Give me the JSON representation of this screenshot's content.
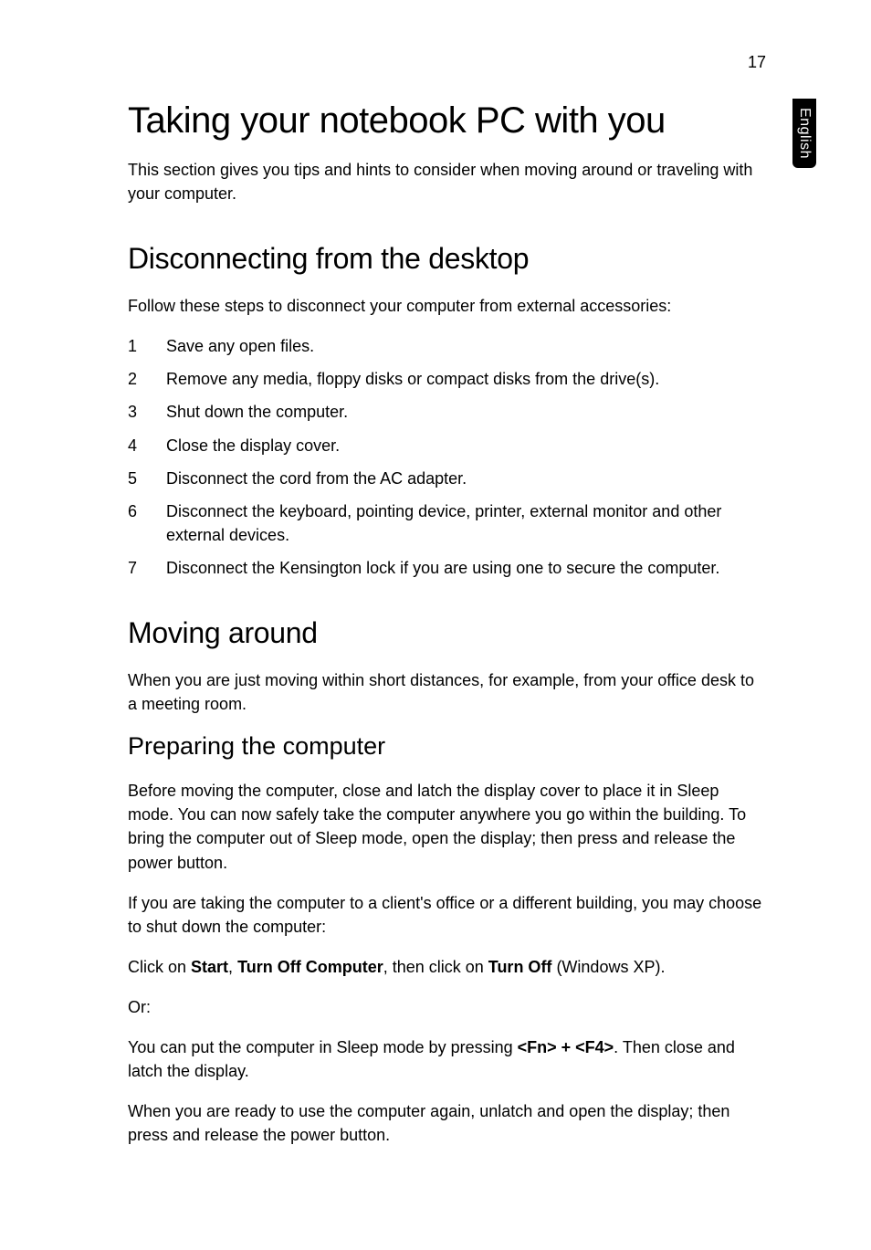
{
  "page_number": "17",
  "side_tab": "English",
  "h1": "Taking your notebook PC with you",
  "intro": "This section gives you tips and hints to consider when moving around or traveling with your computer.",
  "section1": {
    "heading": "Disconnecting from the desktop",
    "intro": "Follow these steps to disconnect your computer from external accessories:",
    "steps": [
      {
        "n": "1",
        "t": "Save any open files."
      },
      {
        "n": "2",
        "t": "Remove any media, floppy disks or compact disks from the drive(s)."
      },
      {
        "n": "3",
        "t": "Shut down the computer."
      },
      {
        "n": "4",
        "t": "Close the display cover."
      },
      {
        "n": "5",
        "t": "Disconnect the cord from the AC adapter."
      },
      {
        "n": "6",
        "t": "Disconnect the keyboard, pointing device, printer, external monitor and other external devices."
      },
      {
        "n": "7",
        "t": "Disconnect the Kensington lock if you are using one to secure the computer."
      }
    ]
  },
  "section2": {
    "heading": "Moving around",
    "intro": "When you are just moving within short distances, for example, from your office desk to a meeting room.",
    "sub": {
      "heading": "Preparing the computer",
      "p1": "Before moving the computer, close and latch the display cover to place it in Sleep mode. You can now safely take the computer anywhere you go within the building. To bring the computer out of Sleep mode, open the display; then press and release the power button.",
      "p2": "If you are taking the computer to a client's office or a different building, you may choose to shut down the computer:",
      "p3_pre": "Click on ",
      "p3_bold1": "Start",
      "p3_mid1": ", ",
      "p3_bold2": "Turn Off Computer",
      "p3_mid2": ", then click on ",
      "p3_bold3": "Turn Off",
      "p3_post": " (Windows XP).",
      "p4": "Or:",
      "p5_pre": "You can put the computer in Sleep mode by pressing ",
      "p5_bold": "<Fn> + <F4>",
      "p5_post": ". Then close and latch the display.",
      "p6": "When you are ready to use the computer again, unlatch and open the display; then press and release the power button."
    }
  }
}
